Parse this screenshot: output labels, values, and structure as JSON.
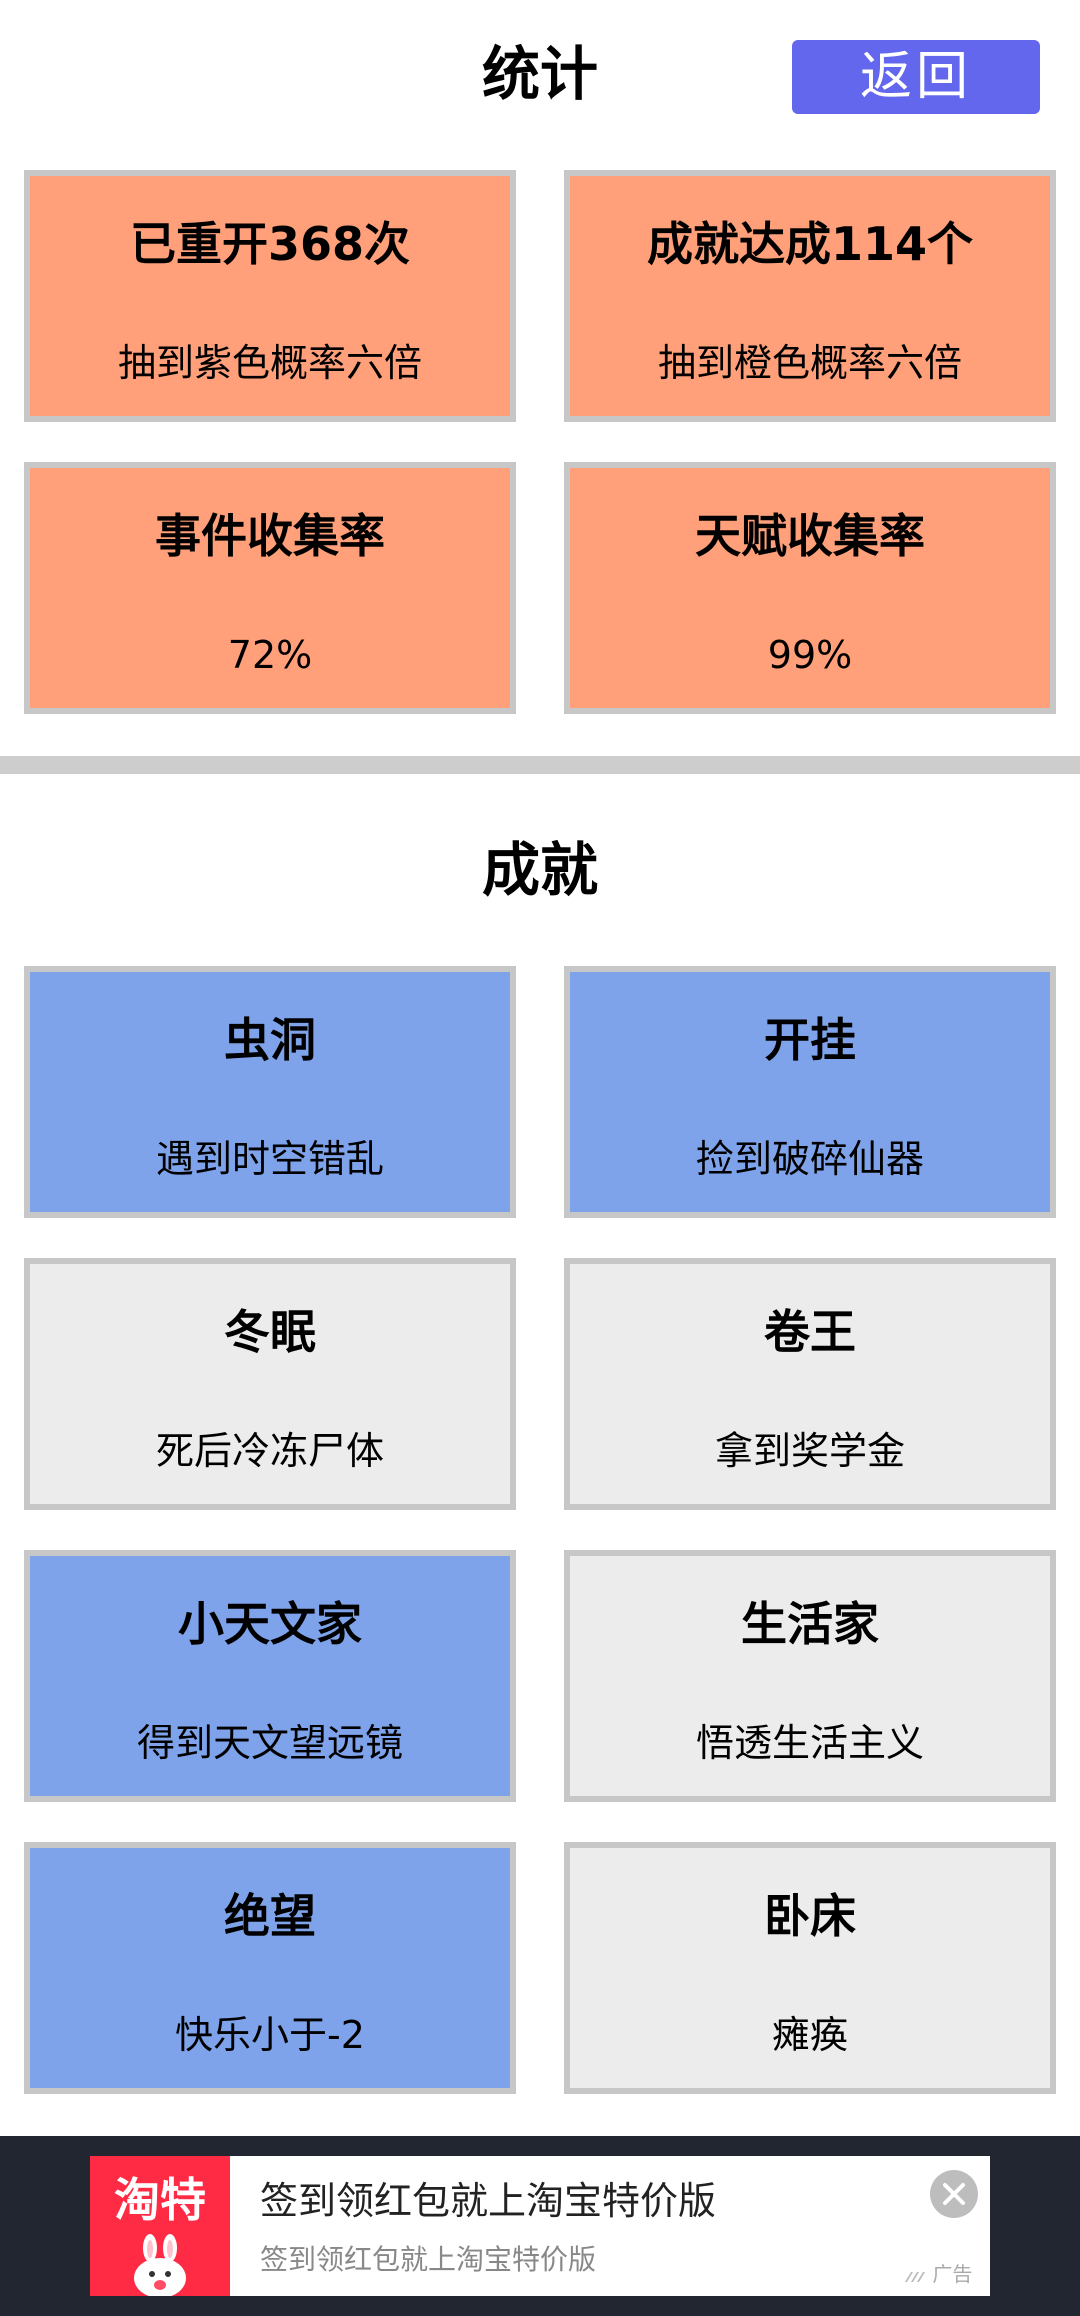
{
  "header": {
    "title": "统计",
    "back_label": "返回"
  },
  "stats": [
    {
      "title": "已重开368次",
      "subtitle": "抽到紫色概率六倍"
    },
    {
      "title": "成就达成114个",
      "subtitle": "抽到橙色概率六倍"
    },
    {
      "title": "事件收集率",
      "subtitle": "72%"
    },
    {
      "title": "天赋收集率",
      "subtitle": "99%"
    }
  ],
  "achievements_section": {
    "title": "成就",
    "items": [
      {
        "title": "虫洞",
        "subtitle": "遇到时空错乱",
        "achieved": true
      },
      {
        "title": "开挂",
        "subtitle": "捡到破碎仙器",
        "achieved": true
      },
      {
        "title": "冬眠",
        "subtitle": "死后冷冻尸体",
        "achieved": false
      },
      {
        "title": "卷王",
        "subtitle": "拿到奖学金",
        "achieved": false
      },
      {
        "title": "小天文家",
        "subtitle": "得到天文望远镜",
        "achieved": true
      },
      {
        "title": "生活家",
        "subtitle": "悟透生活主义",
        "achieved": false
      },
      {
        "title": "绝望",
        "subtitle": "快乐小于-2",
        "achieved": true
      },
      {
        "title": "卧床",
        "subtitle": "瘫痪",
        "achieved": false
      }
    ]
  },
  "ad": {
    "logo_text": "淘特",
    "title": "签到领红包就上淘宝特价版",
    "subtitle": "签到领红包就上淘宝特价版",
    "tag": "广告",
    "icons": [
      "bunny-mascot-icon",
      "close-icon"
    ]
  },
  "colors": {
    "accent": "#6367ee",
    "stat_card": "#ffa07a",
    "achieved": "#7ea3ea",
    "not_achieved": "#ececec",
    "card_border": "#c7c7c7",
    "ad_logo": "#ff2b44"
  }
}
